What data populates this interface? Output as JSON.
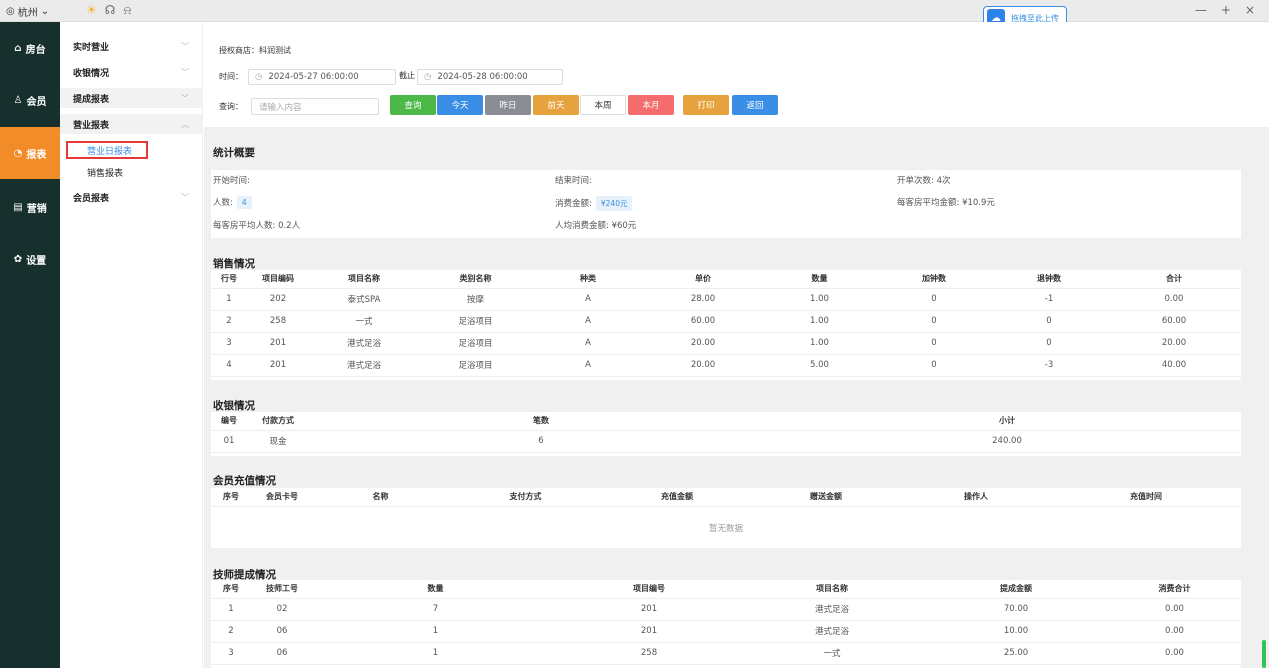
{
  "topbar": {
    "city": "杭州",
    "upload_label": "拖拽至此上传",
    "window_controls": [
      "—",
      "+",
      "×"
    ]
  },
  "leftnav": [
    {
      "icon": "home-icon",
      "label": "房台"
    },
    {
      "icon": "user-icon",
      "label": "会员"
    },
    {
      "icon": "chart-icon",
      "label": "报表"
    },
    {
      "icon": "document-icon",
      "label": "营销"
    },
    {
      "icon": "gear-icon",
      "label": "设置"
    }
  ],
  "submenu": {
    "items": [
      {
        "label": "实时营业",
        "arrow": "﹀"
      },
      {
        "label": "收银情况",
        "arrow": "﹀"
      },
      {
        "label": "提成报表",
        "arrow": "﹀"
      },
      {
        "label": "营业报表",
        "arrow": "︿"
      },
      {
        "label": "营业日报表"
      },
      {
        "label": "销售报表"
      },
      {
        "label": "会员报表",
        "arrow": "﹀"
      }
    ]
  },
  "filter": {
    "store": "授权商店：科润测试",
    "time_label": "时间：",
    "start": "2024-05-27 06:00:00",
    "to_label": "截止",
    "end": "2024-05-28 06:00:00",
    "query_label": "查询：",
    "search_placeholder": "请输入内容",
    "buttons": [
      "查询",
      "今天",
      "昨日",
      "前天",
      "本周",
      "本月",
      "打印",
      "返回"
    ]
  },
  "summary": {
    "title": "统计概要",
    "start_label": "开始时间:",
    "end_label": "结束时间:",
    "open_count": "开单次数:  4次",
    "people_label": "人数:",
    "people_value": "4",
    "spend_label": "消费金额:",
    "spend_value": "¥240元",
    "room_avg_amount": "每客房平均金额:  ¥10.9元",
    "room_avg_people": "每客房平均人数:  0.2人",
    "per_capita": "人均消费金额:  ¥60元"
  },
  "sales": {
    "title": "销售情况",
    "headers": [
      "行号",
      "项目编码",
      "项目名称",
      "类别名称",
      "种类",
      "单价",
      "数量",
      "加钟数",
      "退钟数",
      "合计"
    ],
    "rows": [
      [
        "1",
        "202",
        "泰式SPA",
        "按摩",
        "A",
        "28.00",
        "1.00",
        "0",
        "-1",
        "0.00"
      ],
      [
        "2",
        "258",
        "一式",
        "足浴项目",
        "A",
        "60.00",
        "1.00",
        "0",
        "0",
        "60.00"
      ],
      [
        "3",
        "201",
        "港式足浴",
        "足浴项目",
        "A",
        "20.00",
        "1.00",
        "0",
        "0",
        "20.00"
      ],
      [
        "4",
        "201",
        "港式足浴",
        "足浴项目",
        "A",
        "20.00",
        "5.00",
        "0",
        "-3",
        "40.00"
      ]
    ]
  },
  "cashier": {
    "title": "收银情况",
    "headers": [
      "编号",
      "付款方式",
      "笔数",
      "小计"
    ],
    "rows": [
      [
        "01",
        "现金",
        "6",
        "240.00"
      ]
    ]
  },
  "member_recharge": {
    "title": "会员充值情况",
    "headers": [
      "序号",
      "会员卡号",
      "名称",
      "支付方式",
      "充值金额",
      "赠送金额",
      "操作人",
      "充值时间"
    ],
    "empty": "暂无数据"
  },
  "tech_commission": {
    "title": "技师提成情况",
    "headers": [
      "序号",
      "技师工号",
      "数量",
      "项目编号",
      "项目名称",
      "提成金额",
      "消费合计"
    ],
    "rows": [
      [
        "1",
        "02",
        "7",
        "201",
        "港式足浴",
        "70.00",
        "0.00"
      ],
      [
        "2",
        "06",
        "1",
        "201",
        "港式足浴",
        "10.00",
        "0.00"
      ],
      [
        "3",
        "06",
        "1",
        "258",
        "一式",
        "25.00",
        "0.00"
      ]
    ]
  }
}
